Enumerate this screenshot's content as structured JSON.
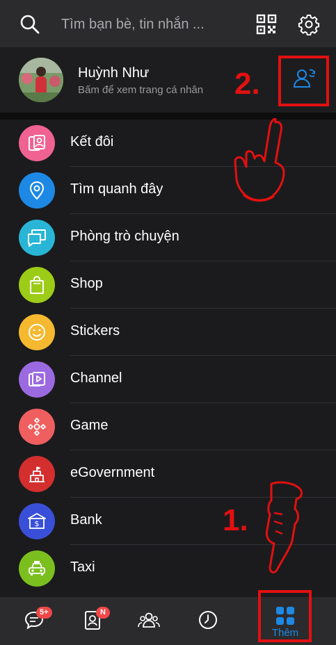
{
  "header": {
    "search_placeholder": "Tìm bạn bè, tin nhắn ...",
    "qr_icon": "qr-code-icon",
    "settings_icon": "gear-icon"
  },
  "profile": {
    "name": "Huỳnh Như",
    "subtitle": "Bấm để xem trang cá nhân",
    "action_icon": "switch-account-icon"
  },
  "menu": {
    "items": [
      {
        "label": "Kết đôi",
        "color": "#f06292",
        "icon": "pair-icon"
      },
      {
        "label": "Tìm quanh đây",
        "color": "#1e88e5",
        "icon": "location-icon"
      },
      {
        "label": "Phòng trò chuyện",
        "color": "#29b6d6",
        "icon": "chat-room-icon"
      },
      {
        "label": "Shop",
        "color": "#9ccc17",
        "icon": "shop-bag-icon"
      },
      {
        "label": "Stickers",
        "color": "#f5b82e",
        "icon": "smile-icon"
      },
      {
        "label": "Channel",
        "color": "#9c6ae0",
        "icon": "channel-icon"
      },
      {
        "label": "Game",
        "color": "#ef5f5f",
        "icon": "gamepad-icon"
      },
      {
        "label": "eGovernment",
        "color": "#d32f2f",
        "icon": "government-icon"
      },
      {
        "label": "Bank",
        "color": "#3a4fd8",
        "icon": "bank-icon"
      },
      {
        "label": "Taxi",
        "color": "#7bbf1f",
        "icon": "taxi-icon"
      }
    ]
  },
  "bottom_nav": {
    "messages_badge": "5+",
    "contacts_badge": "N",
    "more_label": "Thêm",
    "active_color": "#1e88e5"
  },
  "annotations": {
    "step1": "1.",
    "step2": "2.",
    "color": "#e31010"
  }
}
